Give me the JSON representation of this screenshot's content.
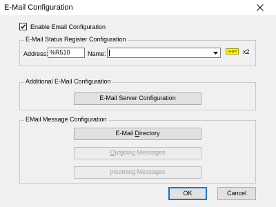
{
  "window": {
    "title": "E-Mail Configuration",
    "close_icon": "close-icon"
  },
  "enable_email": {
    "label": "Enable Email Configuration",
    "checked": true
  },
  "status_register": {
    "legend": "E-Mail Status Register Configuration",
    "address_label": "Address:",
    "address_value": "%R510",
    "name_label": "Name:",
    "name_value": "",
    "type_badge": "16-BIT",
    "multiplier": "x2"
  },
  "additional": {
    "legend": "Additional E-Mail Configuration",
    "server_button": "E-Mail Server Configuration"
  },
  "message": {
    "legend": "EMail Message Configuration",
    "directory_button_pre": "E-Mail ",
    "directory_button_ul": "D",
    "directory_button_post": "irectory",
    "outgoing_button_ul": "O",
    "outgoing_button_post": "utgoing Messages",
    "incoming_button_ul": "I",
    "incoming_button_post": "ncoming Messages"
  },
  "footer": {
    "ok": "OK",
    "cancel": "Cancel"
  }
}
